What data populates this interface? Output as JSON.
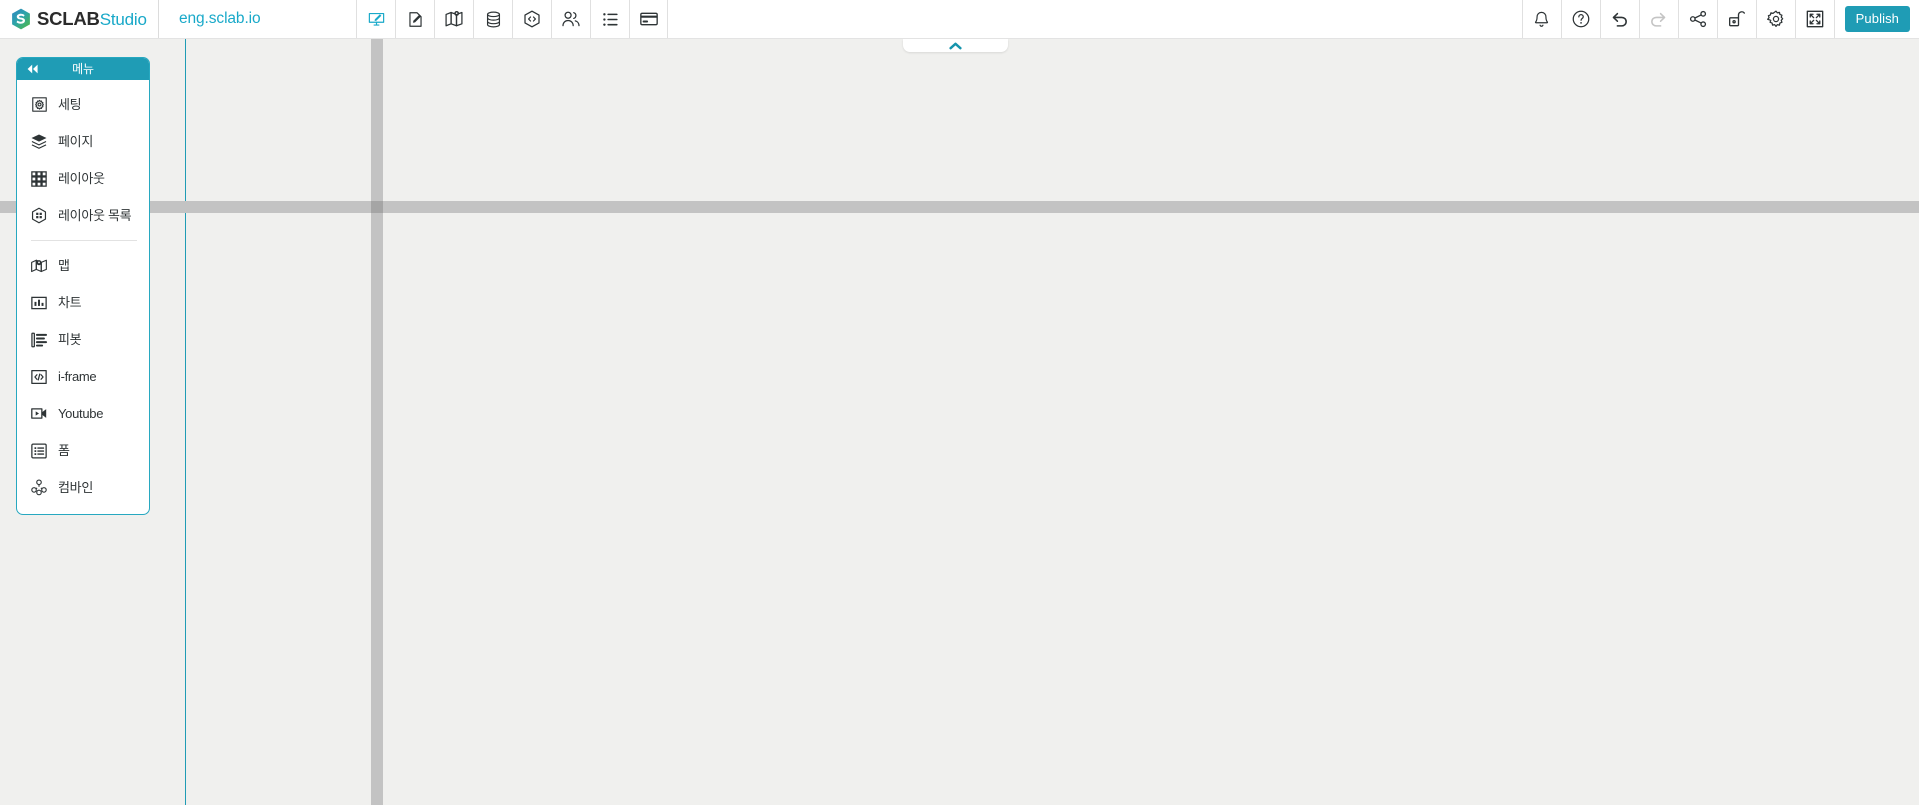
{
  "header": {
    "brand": {
      "name": "SCLAB",
      "suffix": "Studio",
      "mark_icon": "sclab-hexagon-s-logo"
    },
    "site_name": "eng.sclab.io",
    "left_tools": [
      {
        "name": "editor-preview",
        "icon": "monitor-pencil-icon",
        "label": "",
        "active": true,
        "disabled": false
      },
      {
        "name": "content-edit",
        "icon": "document-pencil-icon",
        "label": "",
        "active": false,
        "disabled": false
      },
      {
        "name": "map-tool",
        "icon": "folded-map-pin-icon",
        "label": "",
        "active": false,
        "disabled": false
      },
      {
        "name": "database-tool",
        "icon": "database-cylinder-icon",
        "label": "",
        "active": false,
        "disabled": false
      },
      {
        "name": "code-tool",
        "icon": "hexagon-code-icon",
        "label": "",
        "active": false,
        "disabled": false
      },
      {
        "name": "members-tool",
        "icon": "users-group-icon",
        "label": "",
        "active": false,
        "disabled": false
      },
      {
        "name": "list-tool",
        "icon": "bulleted-list-icon",
        "label": "",
        "active": false,
        "disabled": false
      },
      {
        "name": "billing-tool",
        "icon": "credit-card-icon",
        "label": "",
        "active": false,
        "disabled": false
      }
    ],
    "right_tools": [
      {
        "name": "notifications",
        "icon": "bell-icon",
        "disabled": false
      },
      {
        "name": "help",
        "icon": "question-circle-icon",
        "disabled": false
      },
      {
        "name": "undo",
        "icon": "undo-arrow-icon",
        "disabled": false
      },
      {
        "name": "redo",
        "icon": "redo-arrow-icon",
        "disabled": true
      },
      {
        "name": "share",
        "icon": "share-nodes-icon",
        "disabled": false
      },
      {
        "name": "unlock",
        "icon": "open-padlock-icon",
        "disabled": false
      },
      {
        "name": "settings",
        "icon": "gear-icon",
        "disabled": false
      },
      {
        "name": "fullscreen",
        "icon": "expand-arrows-icon",
        "disabled": false
      }
    ],
    "publish_label": "Publish"
  },
  "collapse_tab": {
    "icon": "chevron-up-icon",
    "name": "collapse-header-tab"
  },
  "menu_panel": {
    "title": "메뉴",
    "collapse_icon": "double-chevron-left-icon",
    "groups": [
      {
        "items": [
          {
            "label": "세팅",
            "icon": "gear-square-icon",
            "name": "menu-item-setting",
            "selected": false
          },
          {
            "label": "페이지",
            "icon": "layers-stack-icon",
            "name": "menu-item-page",
            "selected": false
          },
          {
            "label": "레이아웃",
            "icon": "grid-squares-icon",
            "name": "menu-item-layout",
            "selected": false
          },
          {
            "label": "레이아웃 목록",
            "icon": "hexagon-grid-icon",
            "name": "menu-item-layout-list",
            "selected": true
          }
        ]
      },
      {
        "items": [
          {
            "label": "맵",
            "icon": "map-pin-folded-icon",
            "name": "menu-item-map",
            "selected": false
          },
          {
            "label": "차트",
            "icon": "bar-chart-square-icon",
            "name": "menu-item-chart",
            "selected": false
          },
          {
            "label": "피봇",
            "icon": "pivot-table-icon",
            "name": "menu-item-pivot",
            "selected": false
          },
          {
            "label": "i-frame",
            "icon": "code-brackets-square-icon",
            "name": "menu-item-iframe",
            "selected": false
          },
          {
            "label": "Youtube",
            "icon": "video-play-icon",
            "name": "menu-item-youtube",
            "selected": false
          },
          {
            "label": "폼",
            "icon": "form-list-square-icon",
            "name": "menu-item-form",
            "selected": false
          },
          {
            "label": "컴바인",
            "icon": "combine-nodes-icon",
            "name": "menu-item-combine",
            "selected": false
          }
        ]
      }
    ]
  },
  "scrollbars": {
    "vertical": {
      "name": "vertical-scrollbar"
    },
    "horizontal": {
      "name": "horizontal-scrollbar"
    }
  },
  "colors": {
    "accent": "#1f9cb5",
    "accent_light": "#19a9c9",
    "canvas_bg": "#f0f0ee",
    "scrollbar": "#c3c3c3",
    "text": "#2e3436"
  }
}
